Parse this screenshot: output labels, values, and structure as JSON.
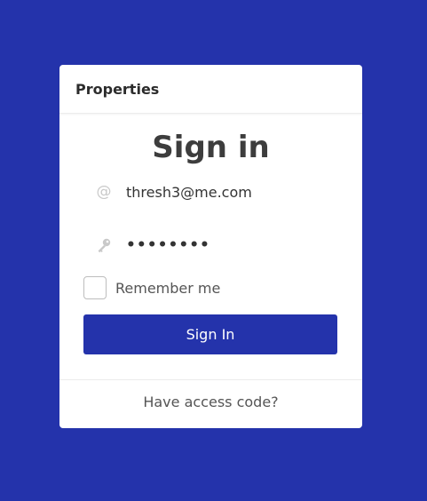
{
  "card": {
    "header_title": "Properties",
    "title": "Sign in"
  },
  "form": {
    "email": {
      "icon": "at-icon",
      "value": "thresh3@me.com"
    },
    "password": {
      "icon": "key-icon",
      "value": "••••••••"
    },
    "remember_label": "Remember me",
    "remember_checked": false,
    "submit_label": "Sign In"
  },
  "footer": {
    "access_code_link": "Have access code?"
  },
  "colors": {
    "background": "#2433ab",
    "button": "#2433ab",
    "card": "#ffffff"
  }
}
